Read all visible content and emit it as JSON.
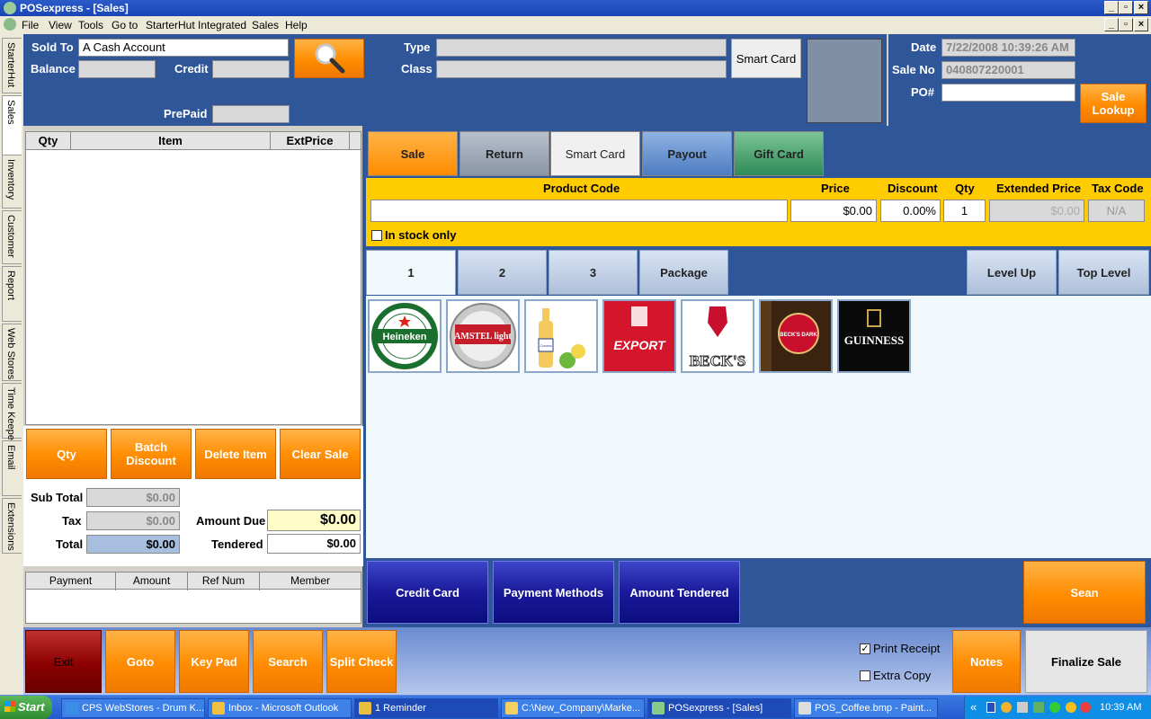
{
  "window": {
    "title": "POSexpress - [Sales]"
  },
  "menu": [
    "File",
    "View",
    "Tools",
    "Go to",
    "StarterHut Integrated",
    "Sales",
    "Help"
  ],
  "side_tabs": [
    "StarterHut",
    "Sales",
    "Inventory",
    "Customer",
    "Report",
    "Web Stores",
    "Time Keeper",
    "Email",
    "Extensions"
  ],
  "header": {
    "sold_to_label": "Sold To",
    "sold_to_value": "A Cash Account",
    "balance_label": "Balance",
    "credit_label": "Credit",
    "prepaid_label": "PrePaid",
    "type_label": "Type",
    "class_label": "Class",
    "smart_card_label": "Smart Card",
    "date_label": "Date",
    "date_value": "7/22/2008 10:39:26 AM",
    "sale_no_label": "Sale No",
    "sale_no_value": "040807220001",
    "po_label": "PO#",
    "po_value": "",
    "sale_lookup_label": "Sale Lookup"
  },
  "items_table": {
    "columns": [
      "Qty",
      "Item",
      "ExtPrice"
    ]
  },
  "mode_tabs": [
    "Sale",
    "Return",
    "Smart Card",
    "Payout",
    "Gift Card"
  ],
  "product_entry": {
    "product_code_label": "Product Code",
    "product_code_value": "",
    "price_label": "Price",
    "price_value": "$0.00",
    "discount_label": "Discount",
    "discount_value": "0.00%",
    "qty_label": "Qty",
    "qty_value": "1",
    "ext_price_label": "Extended Price",
    "ext_price_value": "$0.00",
    "tax_code_label": "Tax Code",
    "tax_code_value": "N/A",
    "in_stock_label": "In stock only"
  },
  "product_pages": [
    "1",
    "2",
    "3",
    "Package"
  ],
  "level_buttons": {
    "level_up": "Level Up",
    "top_level": "Top Level"
  },
  "products": [
    "Heineken",
    "AMSTEL light",
    "Corona",
    "EXPORT",
    "BECK'S",
    "BECK'S DARK",
    "GUINNESS"
  ],
  "item_actions": {
    "qty": "Qty",
    "batch_discount": "Batch Discount",
    "delete_item": "Delete Item",
    "clear_sale": "Clear Sale"
  },
  "totals": {
    "subtotal_label": "Sub Total",
    "subtotal_value": "$0.00",
    "tax_label": "Tax",
    "tax_value": "$0.00",
    "total_label": "Total",
    "total_value": "$0.00",
    "amount_due_label": "Amount Due",
    "amount_due_value": "$0.00",
    "tendered_label": "Tendered",
    "tendered_value": "$0.00"
  },
  "payment_table": {
    "columns": [
      "Payment",
      "Amount",
      "Ref Num",
      "Member"
    ]
  },
  "payment_buttons": {
    "credit_card": "Credit Card",
    "payment_methods": "Payment Methods",
    "amount_tendered": "Amount Tendered",
    "scan": "Sean"
  },
  "bottom_buttons": {
    "exit": "Exit",
    "goto": "Goto",
    "keypad": "Key Pad",
    "search": "Search",
    "split_check": "Split Check",
    "notes": "Notes",
    "finalize": "Finalize Sale"
  },
  "print_receipt_label": "Print Receipt",
  "extra_copy_label": "Extra Copy",
  "taskbar": {
    "start": "Start",
    "tasks": [
      "CPS WebStores - Drum K...",
      "Inbox - Microsoft Outlook",
      "1 Reminder",
      "C:\\New_Company\\Marke...",
      "POSexpress - [Sales]",
      "POS_Coffee.bmp - Paint..."
    ],
    "clock": "10:39 AM"
  },
  "colors": {
    "panel_blue": "#2f5699",
    "accent_orange": "#ff8c00",
    "entry_yellow": "#ffcc00"
  }
}
